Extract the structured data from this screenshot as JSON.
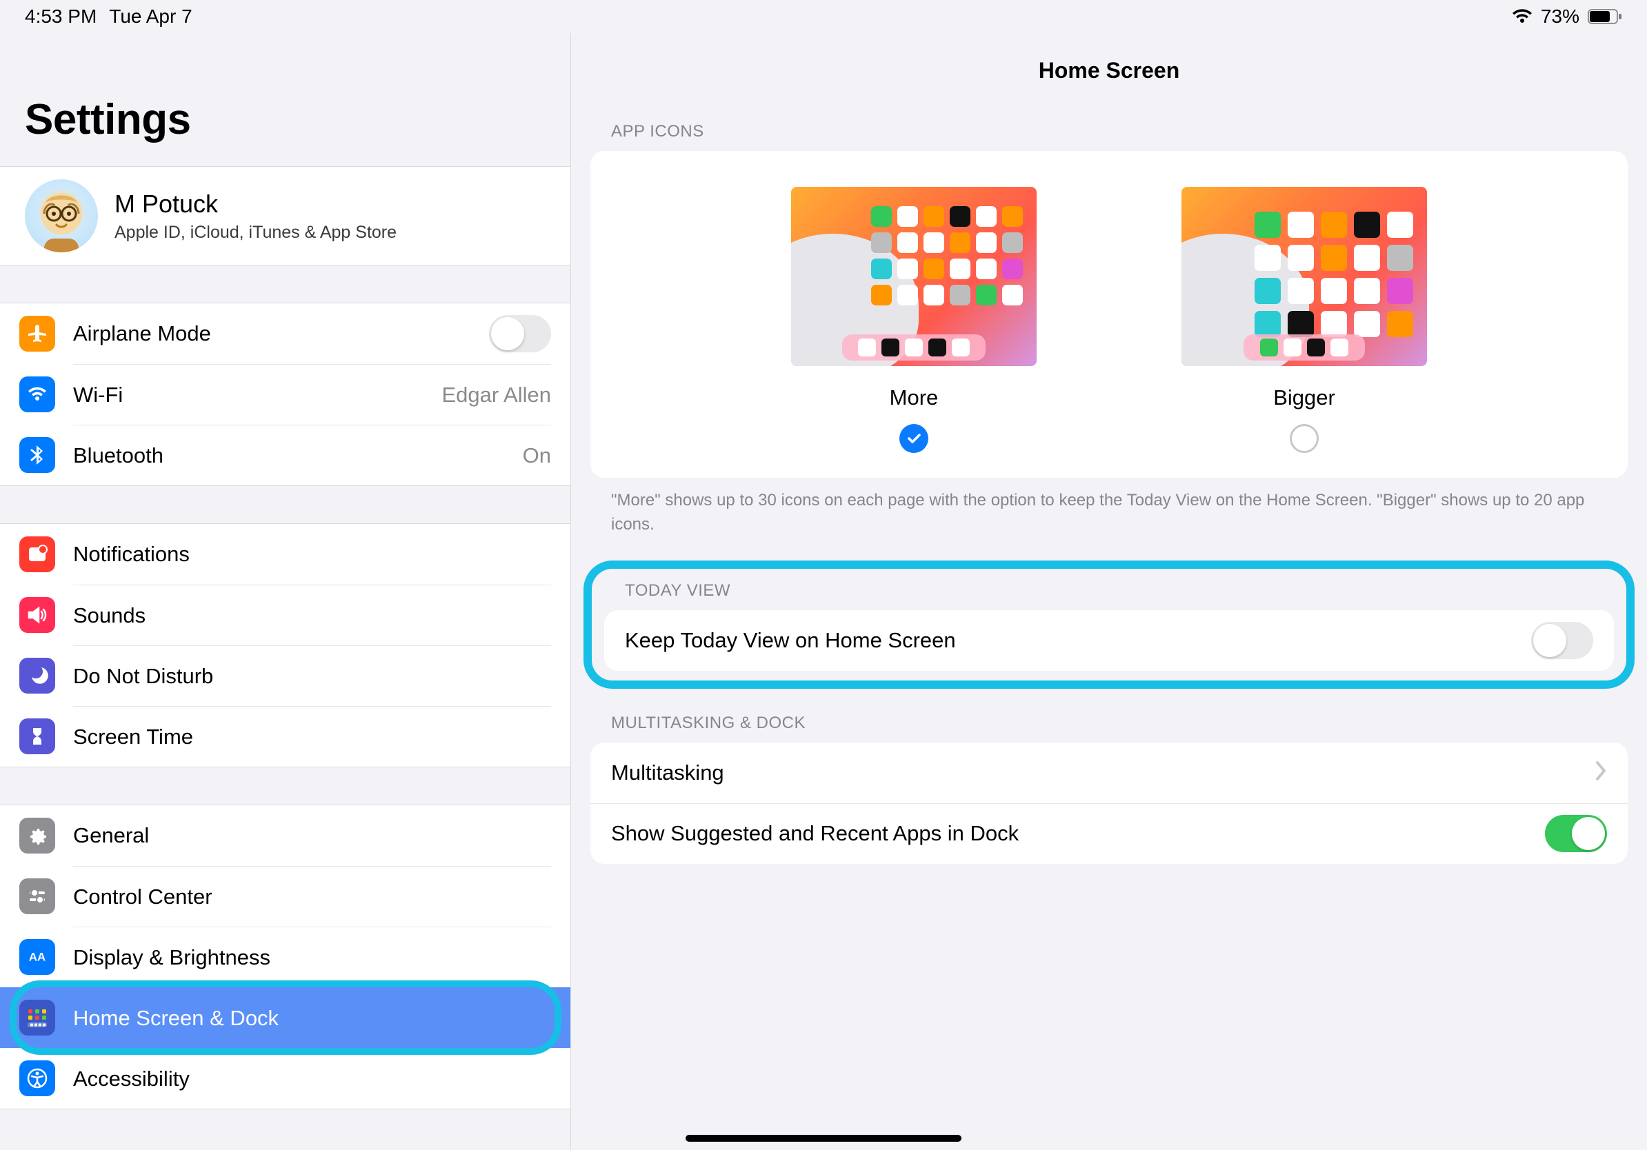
{
  "status": {
    "time": "4:53 PM",
    "date": "Tue Apr 7",
    "battery_pct": "73%"
  },
  "page_title": "Settings",
  "account": {
    "name": "M Potuck",
    "subtitle": "Apple ID, iCloud, iTunes & App Store"
  },
  "sidebar": {
    "connectivity": [
      {
        "label": "Airplane Mode",
        "value": ""
      },
      {
        "label": "Wi-Fi",
        "value": "Edgar Allen"
      },
      {
        "label": "Bluetooth",
        "value": "On"
      }
    ],
    "alerts": [
      {
        "label": "Notifications"
      },
      {
        "label": "Sounds"
      },
      {
        "label": "Do Not Disturb"
      },
      {
        "label": "Screen Time"
      }
    ],
    "general": [
      {
        "label": "General"
      },
      {
        "label": "Control Center"
      },
      {
        "label": "Display & Brightness"
      },
      {
        "label": "Home Screen & Dock"
      },
      {
        "label": "Accessibility"
      }
    ]
  },
  "detail": {
    "title": "Home Screen",
    "app_icons": {
      "header": "APP ICONS",
      "options": [
        {
          "label": "More",
          "selected": true
        },
        {
          "label": "Bigger",
          "selected": false
        }
      ],
      "footer": "\"More\" shows up to 30 icons on each page with the option to keep the Today View on the Home Screen. \"Bigger\" shows up to 20 app icons."
    },
    "today_view": {
      "header": "TODAY VIEW",
      "row_label": "Keep Today View on Home Screen",
      "enabled": false
    },
    "multitasking": {
      "header": "MULTITASKING & DOCK",
      "rows": [
        {
          "label": "Multitasking",
          "type": "disclosure"
        },
        {
          "label": "Show Suggested and Recent Apps in Dock",
          "type": "toggle",
          "enabled": true
        }
      ]
    }
  }
}
